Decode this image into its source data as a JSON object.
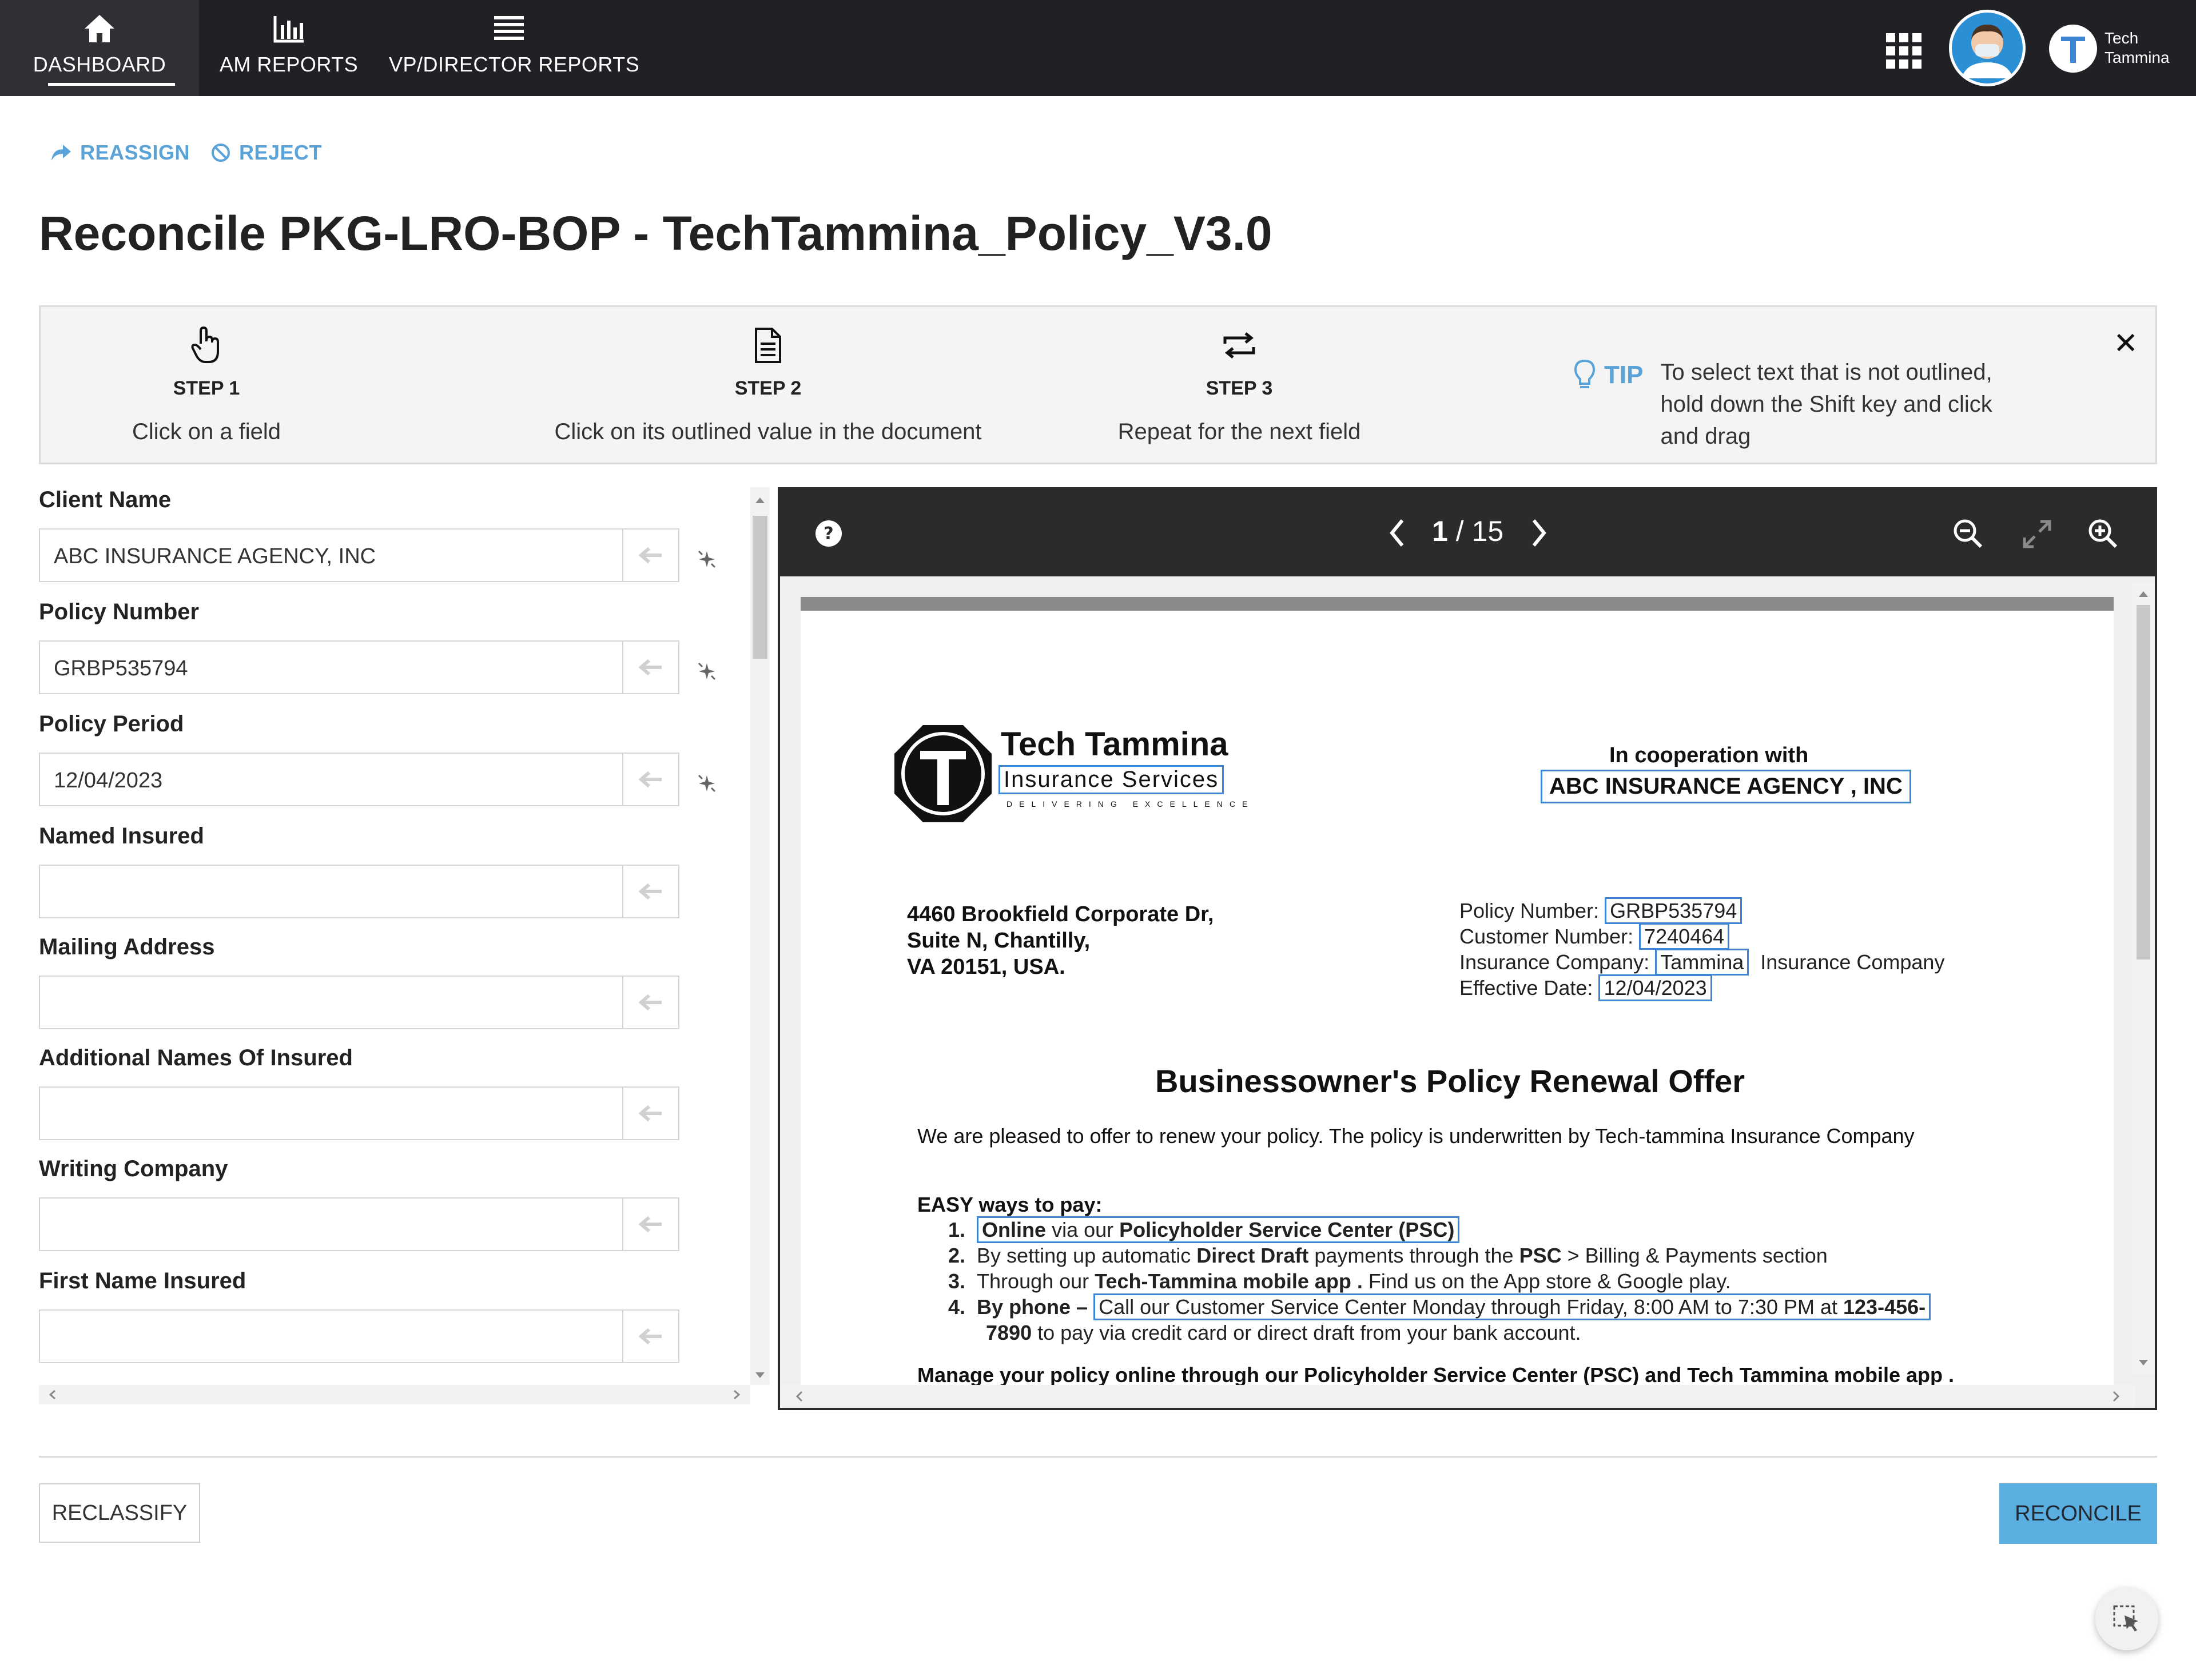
{
  "nav": {
    "items": [
      {
        "label": "DASHBOARD",
        "icon": "home-icon",
        "active": true
      },
      {
        "label": "AM REPORTS",
        "icon": "bar-chart-icon"
      },
      {
        "label": "VP/DIRECTOR REPORTS",
        "icon": "list-icon"
      }
    ],
    "brand": {
      "line1": "Tech",
      "line2": "Tammina"
    }
  },
  "actions": {
    "reassign": "REASSIGN",
    "reject": "REJECT"
  },
  "page_title": "Reconcile PKG-LRO-BOP - TechTammina_Policy_V3.0",
  "steps": [
    {
      "title": "STEP 1",
      "desc": "Click on a field",
      "icon": "hand-pointer-icon"
    },
    {
      "title": "STEP 2",
      "desc": "Click on its outlined value in the document",
      "icon": "document-icon"
    },
    {
      "title": "STEP 3",
      "desc": "Repeat for the next field",
      "icon": "repeat-icon"
    }
  ],
  "tip": {
    "label": "TIP",
    "text": "To select text that is not outlined, hold down the Shift key and click and drag"
  },
  "fields": [
    {
      "label": "Client Name",
      "value": "ABC INSURANCE AGENCY, INC"
    },
    {
      "label": "Policy Number",
      "value": "GRBP535794"
    },
    {
      "label": "Policy Period",
      "value": "12/04/2023"
    },
    {
      "label": "Named Insured",
      "value": ""
    },
    {
      "label": "Mailing Address",
      "value": ""
    },
    {
      "label": "Additional Names Of Insured",
      "value": ""
    },
    {
      "label": "Writing Company",
      "value": ""
    },
    {
      "label": "First Name Insured",
      "value": ""
    }
  ],
  "viewer": {
    "current_page": "1",
    "separator": "/",
    "total_pages": "15"
  },
  "document": {
    "logo_title": "Tech Tammina",
    "logo_sub": "Insurance Services",
    "logo_tag": "DELIVERING EXCELLENCE",
    "coop_label": "In cooperation with",
    "coop_agency": "ABC INSURANCE AGENCY , INC",
    "address": [
      "4460 Brookfield Corporate Dr,",
      "Suite N, Chantilly,",
      "VA 20151, USA."
    ],
    "policy_number_label": "Policy Number:",
    "policy_number": "GRBP535794",
    "customer_number_label": "Customer Number:",
    "customer_number": "7240464",
    "insurance_company_label": "Insurance Company:",
    "insurance_company": "Tammina",
    "insurance_company_suffix": "Insurance Company",
    "effective_date_label": "Effective Date:",
    "effective_date": "12/04/2023",
    "heading": "Businessowner's Policy Renewal Offer",
    "intro_a": "We are pleased to offer to renew your policy. The policy is underwritten by ",
    "intro_b": "Tech-tammina Insurance Company",
    "easy_ways": "EASY ways to pay:",
    "pay_1_a": "Online",
    "pay_1_b": " via our ",
    "pay_1_c": "Policyholder Service Center (PSC)",
    "pay_2_a": "By setting up automatic ",
    "pay_2_b": "Direct Draft",
    "pay_2_c": " payments through the ",
    "pay_2_d": "PSC",
    "pay_2_e": " > Billing & Payments section",
    "pay_3_a": "Through our ",
    "pay_3_b": "Tech-Tammina mobile app .",
    "pay_3_c": " Find us on the App store & Google play.",
    "pay_4_a": "By phone – ",
    "pay_4_b": "Call our Customer Service Center Monday through Friday, 8:00 AM to 7:30 PM at ",
    "pay_4_c": "123-456-",
    "pay_4_d": "7890",
    "pay_4_e": " to pay via credit card or direct draft from your bank account.",
    "manage": "Manage your policy online through our Policyholder Service Center (PSC) and Tech Tammina mobile app ."
  },
  "footer": {
    "reclassify": "RECLASSIFY",
    "reconcile": "RECONCILE"
  },
  "colors": {
    "accent": "#5aa3d8",
    "nav_bg": "#1f2124",
    "highlight_box": "#3d86d6",
    "reconcile_bg": "#5aaee0"
  }
}
